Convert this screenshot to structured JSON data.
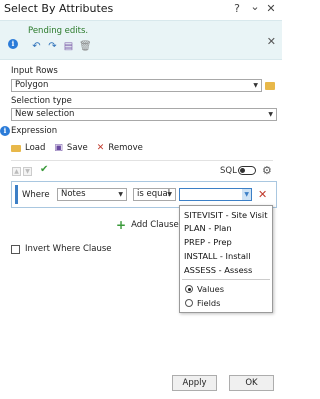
{
  "window": {
    "title": "Select By Attributes",
    "help": "?",
    "minimize": "⌄",
    "close": "✕"
  },
  "edits": {
    "message": "Pending edits.",
    "close": "✕"
  },
  "input_rows": {
    "label": "Input Rows",
    "value": "Polygon"
  },
  "selection_type": {
    "label": "Selection type",
    "value": "New selection"
  },
  "expression": {
    "label": "Expression",
    "load_label": "Load",
    "save_label": "Save",
    "remove_label": "Remove",
    "sql_label": "SQL"
  },
  "clause": {
    "where_label": "Where",
    "field": "Notes",
    "operator": "is equal",
    "value": ""
  },
  "add_clause_label": "Add Clause",
  "invert_label": "Invert Where Clause",
  "dropdown": {
    "options": [
      "SITEVISIT - Site Visit",
      "PLAN - Plan",
      "PREP - Prep",
      "INSTALL - Install",
      "ASSESS - Assess"
    ],
    "radio_values": "Values",
    "radio_fields": "Fields",
    "selected_radio": "Values"
  },
  "buttons": {
    "apply": "Apply",
    "ok": "OK"
  }
}
